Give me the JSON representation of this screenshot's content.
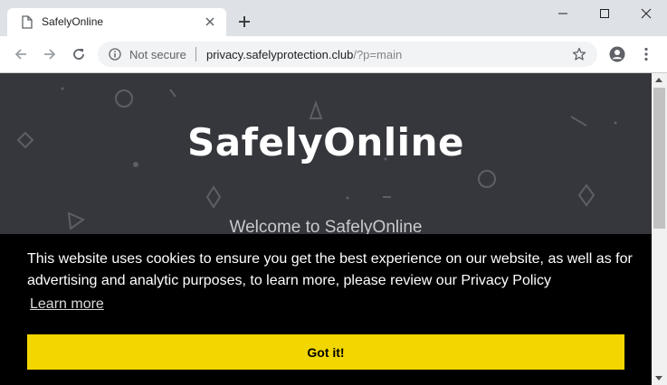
{
  "browser": {
    "tab_title": "SafelyOnline",
    "security_label": "Not secure",
    "url_host": "privacy.safelyprotection.club",
    "url_path": "/?p=main"
  },
  "page": {
    "site_title": "SafelyOnline",
    "welcome_text": "Welcome to SafelyOnline"
  },
  "cookie_banner": {
    "message": "This website uses cookies to ensure you get the best experience on our website, as well as for advertising and analytic purposes, to learn more, please review our Privacy Policy",
    "learn_more_label": "Learn more",
    "accept_label": "Got it!"
  },
  "colors": {
    "page_background": "#35373c",
    "banner_background": "#000000",
    "accept_button": "#f1d600"
  }
}
